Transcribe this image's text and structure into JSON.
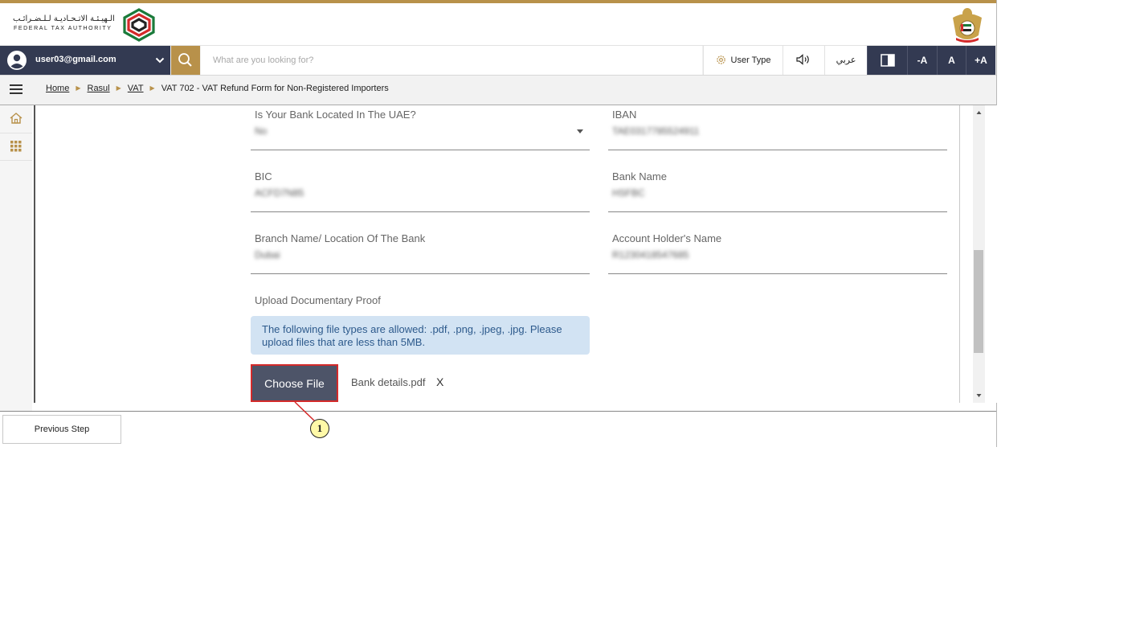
{
  "header": {
    "logo_arabic": "الـهيـئـة الاتـحـاديـة لـلـضـرائـب",
    "logo_english": "FEDERAL TAX AUTHORITY"
  },
  "navbar": {
    "user_email": "user03@gmail.com",
    "search_placeholder": "What are you looking for?",
    "user_type_label": "User Type",
    "language_label": "عربي",
    "font_decrease": "-A",
    "font_normal": "A",
    "font_increase": "+A"
  },
  "breadcrumb": {
    "items": [
      "Home",
      "Rasul",
      "VAT"
    ],
    "current": "VAT 702 - VAT Refund Form for Non-Registered Importers"
  },
  "form": {
    "bank_in_uae": {
      "label": "Is Your Bank Located In The UAE?",
      "value": "No"
    },
    "iban": {
      "label": "IBAN",
      "value": "TAE0317785524911"
    },
    "bic": {
      "label": "BIC",
      "value": "ACFD7N85"
    },
    "bank_name": {
      "label": "Bank Name",
      "value": "HSFBC"
    },
    "branch": {
      "label": "Branch Name/ Location Of The Bank",
      "value": "Dubai"
    },
    "account_holder": {
      "label": "Account Holder's Name",
      "value": "R1230418547685"
    },
    "upload_label": "Upload Documentary Proof",
    "upload_info": "The following file types are allowed: .pdf, .png, .jpeg, .jpg. Please upload files that are less than 5MB.",
    "choose_file_label": "Choose File",
    "file_name": "Bank details.pdf",
    "remove_label": "X"
  },
  "footer": {
    "previous_label": "Previous Step"
  },
  "callout": {
    "number": "1"
  },
  "colors": {
    "accent_gold": "#b8914a",
    "navy": "#333a52",
    "info_bg": "#d2e3f3",
    "highlight_red": "#d42a2a"
  }
}
